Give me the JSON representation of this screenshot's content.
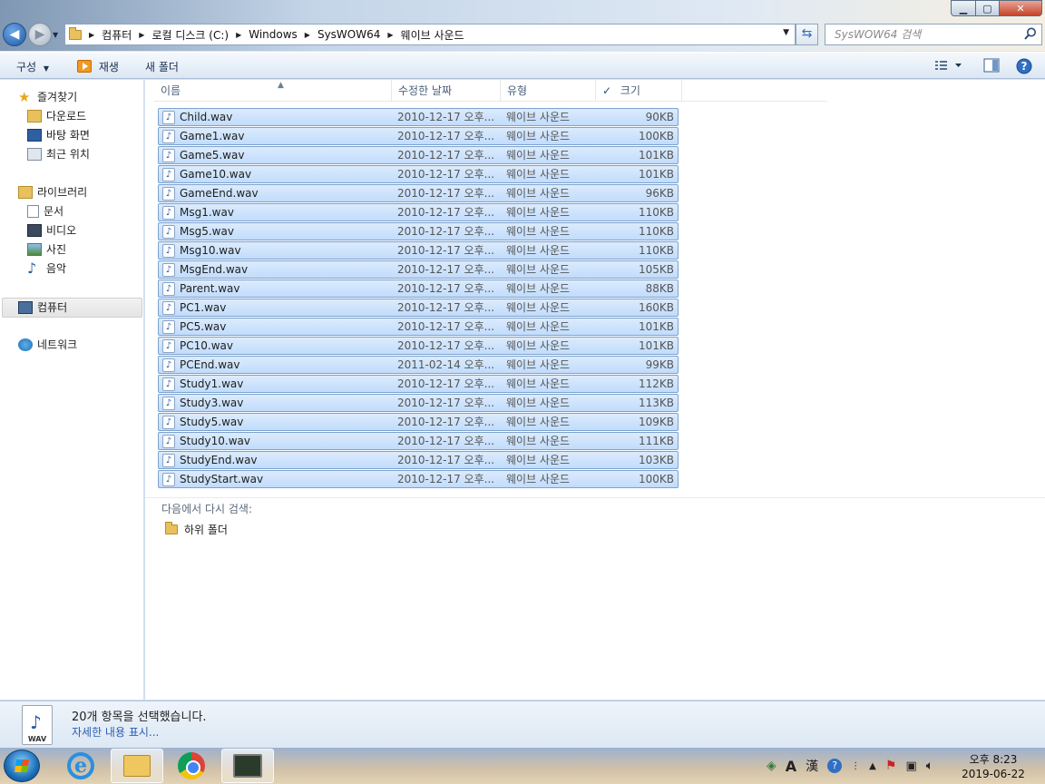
{
  "window": {
    "buttons": {
      "minimize": "▁",
      "maximize": "▢",
      "close": "✕"
    }
  },
  "address": {
    "crumbs": [
      "컴퓨터",
      "로컬 디스크 (C:)",
      "Windows",
      "SysWOW64",
      "웨이브 사운드"
    ],
    "search_placeholder": "SysWOW64 검색"
  },
  "commandbar": {
    "organize": "구성",
    "play": "재생",
    "new_folder": "새 폴더"
  },
  "nav": {
    "favorites": {
      "label": "즐겨찾기",
      "items": [
        "다운로드",
        "바탕 화면",
        "최근 위치"
      ]
    },
    "libraries": {
      "label": "라이브러리",
      "items": [
        "문서",
        "비디오",
        "사진",
        "음악"
      ]
    },
    "computer": "컴퓨터",
    "network": "네트워크"
  },
  "columns": {
    "name": "이름",
    "modified": "수정한 날짜",
    "type": "유형",
    "size": "크기",
    "checkmark": "✓"
  },
  "files": [
    {
      "name": "Child.wav",
      "date": "2010-12-17 오후...",
      "type": "웨이브 사운드",
      "size": "90KB"
    },
    {
      "name": "Game1.wav",
      "date": "2010-12-17 오후...",
      "type": "웨이브 사운드",
      "size": "100KB"
    },
    {
      "name": "Game5.wav",
      "date": "2010-12-17 오후...",
      "type": "웨이브 사운드",
      "size": "101KB"
    },
    {
      "name": "Game10.wav",
      "date": "2010-12-17 오후...",
      "type": "웨이브 사운드",
      "size": "101KB"
    },
    {
      "name": "GameEnd.wav",
      "date": "2010-12-17 오후...",
      "type": "웨이브 사운드",
      "size": "96KB"
    },
    {
      "name": "Msg1.wav",
      "date": "2010-12-17 오후...",
      "type": "웨이브 사운드",
      "size": "110KB"
    },
    {
      "name": "Msg5.wav",
      "date": "2010-12-17 오후...",
      "type": "웨이브 사운드",
      "size": "110KB"
    },
    {
      "name": "Msg10.wav",
      "date": "2010-12-17 오후...",
      "type": "웨이브 사운드",
      "size": "110KB"
    },
    {
      "name": "MsgEnd.wav",
      "date": "2010-12-17 오후...",
      "type": "웨이브 사운드",
      "size": "105KB"
    },
    {
      "name": "Parent.wav",
      "date": "2010-12-17 오후...",
      "type": "웨이브 사운드",
      "size": "88KB"
    },
    {
      "name": "PC1.wav",
      "date": "2010-12-17 오후...",
      "type": "웨이브 사운드",
      "size": "160KB"
    },
    {
      "name": "PC5.wav",
      "date": "2010-12-17 오후...",
      "type": "웨이브 사운드",
      "size": "101KB"
    },
    {
      "name": "PC10.wav",
      "date": "2010-12-17 오후...",
      "type": "웨이브 사운드",
      "size": "101KB"
    },
    {
      "name": "PCEnd.wav",
      "date": "2011-02-14 오후...",
      "type": "웨이브 사운드",
      "size": "99KB"
    },
    {
      "name": "Study1.wav",
      "date": "2010-12-17 오후...",
      "type": "웨이브 사운드",
      "size": "112KB"
    },
    {
      "name": "Study3.wav",
      "date": "2010-12-17 오후...",
      "type": "웨이브 사운드",
      "size": "113KB"
    },
    {
      "name": "Study5.wav",
      "date": "2010-12-17 오후...",
      "type": "웨이브 사운드",
      "size": "109KB"
    },
    {
      "name": "Study10.wav",
      "date": "2010-12-17 오후...",
      "type": "웨이브 사운드",
      "size": "111KB"
    },
    {
      "name": "StudyEnd.wav",
      "date": "2010-12-17 오후...",
      "type": "웨이브 사운드",
      "size": "103KB"
    },
    {
      "name": "StudyStart.wav",
      "date": "2010-12-17 오후...",
      "type": "웨이브 사운드",
      "size": "100KB"
    }
  ],
  "search_again": {
    "label": "다음에서 다시 검색:",
    "subfolder": "하위 폴더"
  },
  "details": {
    "count": "20개 항목을 선택했습니다.",
    "show_more": "자세한 내용 표시...",
    "icon_label": "WAV"
  },
  "taskbar": {
    "tray": {
      "lang_a": "A",
      "lang_han": "漢",
      "help": "?"
    },
    "time": "오후 8:23",
    "date": "2019-06-22"
  },
  "colors": {
    "selection": "#c9e0fc",
    "selection_border": "#7da2ce",
    "link": "#2a5db0"
  }
}
